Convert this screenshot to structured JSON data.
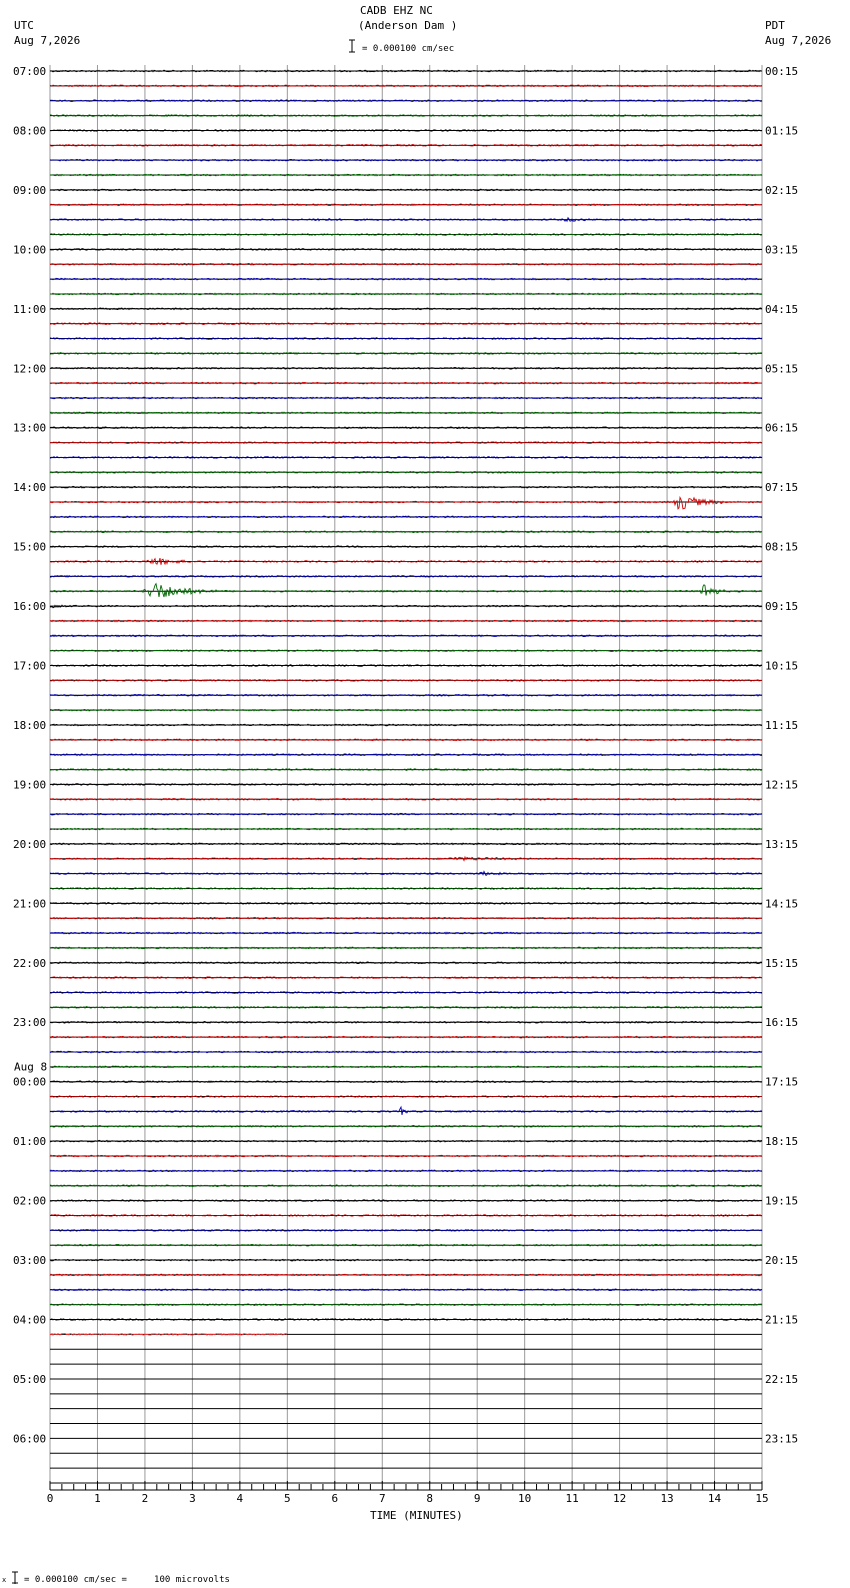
{
  "header": {
    "station": "CADB EHZ NC",
    "location": "(Anderson Dam )",
    "scale_text": "= 0.000100 cm/sec",
    "left_tz": "UTC",
    "left_date": "Aug 7,2026",
    "right_tz": "PDT",
    "right_date": "Aug 7,2026"
  },
  "footer": {
    "calibration": "= 0.000100 cm/sec =     100 microvolts"
  },
  "chart_data": {
    "type": "line",
    "xlabel": "TIME (MINUTES)",
    "xlim": [
      0,
      15
    ],
    "x_ticks": [
      "0",
      "1",
      "2",
      "3",
      "4",
      "5",
      "6",
      "7",
      "8",
      "9",
      "10",
      "11",
      "12",
      "13",
      "14",
      "15"
    ],
    "trace_count": 96,
    "trace_minutes": 15,
    "trace_colors": [
      "#000000",
      "#cc0000",
      "#0000aa",
      "#006600"
    ],
    "partial_trace": {
      "index": 85,
      "color": "#ff3333",
      "end_minute": 5
    },
    "grid": true,
    "left_labels": [
      {
        "row": 0,
        "text": "07:00"
      },
      {
        "row": 4,
        "text": "08:00"
      },
      {
        "row": 8,
        "text": "09:00"
      },
      {
        "row": 12,
        "text": "10:00"
      },
      {
        "row": 16,
        "text": "11:00"
      },
      {
        "row": 20,
        "text": "12:00"
      },
      {
        "row": 24,
        "text": "13:00"
      },
      {
        "row": 28,
        "text": "14:00"
      },
      {
        "row": 32,
        "text": "15:00"
      },
      {
        "row": 36,
        "text": "16:00"
      },
      {
        "row": 40,
        "text": "17:00"
      },
      {
        "row": 44,
        "text": "18:00"
      },
      {
        "row": 48,
        "text": "19:00"
      },
      {
        "row": 52,
        "text": "20:00"
      },
      {
        "row": 56,
        "text": "21:00"
      },
      {
        "row": 60,
        "text": "22:00"
      },
      {
        "row": 64,
        "text": "23:00"
      },
      {
        "row": 68,
        "text": "00:00",
        "prefix": "Aug 8"
      },
      {
        "row": 72,
        "text": "01:00"
      },
      {
        "row": 76,
        "text": "02:00"
      },
      {
        "row": 80,
        "text": "03:00"
      },
      {
        "row": 84,
        "text": "04:00"
      },
      {
        "row": 88,
        "text": "05:00"
      },
      {
        "row": 92,
        "text": "06:00"
      }
    ],
    "right_labels": [
      {
        "row": 0,
        "text": "00:15"
      },
      {
        "row": 4,
        "text": "01:15"
      },
      {
        "row": 8,
        "text": "02:15"
      },
      {
        "row": 12,
        "text": "03:15"
      },
      {
        "row": 16,
        "text": "04:15"
      },
      {
        "row": 20,
        "text": "05:15"
      },
      {
        "row": 24,
        "text": "06:15"
      },
      {
        "row": 28,
        "text": "07:15"
      },
      {
        "row": 32,
        "text": "08:15"
      },
      {
        "row": 36,
        "text": "09:15"
      },
      {
        "row": 40,
        "text": "10:15"
      },
      {
        "row": 44,
        "text": "11:15"
      },
      {
        "row": 48,
        "text": "12:15"
      },
      {
        "row": 52,
        "text": "13:15"
      },
      {
        "row": 56,
        "text": "14:15"
      },
      {
        "row": 60,
        "text": "15:15"
      },
      {
        "row": 64,
        "text": "16:15"
      },
      {
        "row": 68,
        "text": "17:15"
      },
      {
        "row": 72,
        "text": "18:15"
      },
      {
        "row": 76,
        "text": "19:15"
      },
      {
        "row": 80,
        "text": "20:15"
      },
      {
        "row": 84,
        "text": "21:15"
      },
      {
        "row": 88,
        "text": "22:15"
      },
      {
        "row": 92,
        "text": "23:15"
      }
    ],
    "events": [
      {
        "trace": 10,
        "start": 5.5,
        "end": 6.2,
        "amp": 1.2
      },
      {
        "trace": 10,
        "start": 10.8,
        "end": 11.5,
        "amp": 1.5
      },
      {
        "trace": 29,
        "start": 13.1,
        "end": 14.2,
        "amp": 8
      },
      {
        "trace": 33,
        "start": 2.05,
        "end": 3.0,
        "amp": 4
      },
      {
        "trace": 35,
        "start": 1.95,
        "end": 3.5,
        "amp": 9
      },
      {
        "trace": 35,
        "start": 13.7,
        "end": 14.2,
        "amp": 10
      },
      {
        "trace": 36,
        "start": 0.0,
        "end": 0.35,
        "amp": 2
      },
      {
        "trace": 53,
        "start": 8.3,
        "end": 10.3,
        "amp": 1.3
      },
      {
        "trace": 54,
        "start": 9.0,
        "end": 9.6,
        "amp": 2
      },
      {
        "trace": 70,
        "start": 7.35,
        "end": 7.6,
        "amp": 4
      }
    ]
  }
}
